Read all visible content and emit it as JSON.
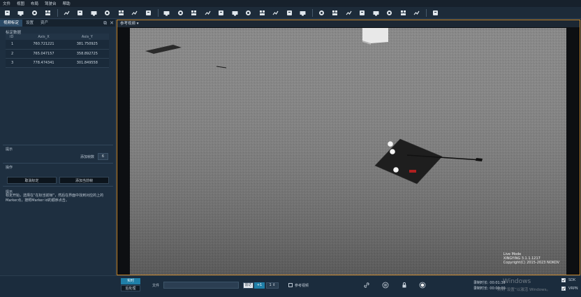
{
  "menu": [
    "文件",
    "视图",
    "布局",
    "驾驶台",
    "帮助"
  ],
  "toolbar_icons": [
    "new-file-icon",
    "open-file-icon",
    "save-icon",
    "save-as-icon",
    "link-icon",
    "export-icon",
    "camera-icon",
    "device-icon",
    "film-icon",
    "layers-icon",
    "stack-icon",
    "monitor-icon",
    "settings-icon",
    "window-icon",
    "window-icon",
    "window-icon",
    "window-icon",
    "window-icon",
    "window-icon",
    "window-icon",
    "window-icon",
    "window-icon",
    "camera-icon",
    "record-icon",
    "globe-icon",
    "gauge-icon",
    "graph-icon",
    "bar-chart-icon",
    "map-pin-icon",
    "folder-icon",
    "list-icon"
  ],
  "left_panel": {
    "tabs": [
      "视频标定",
      "设置",
      "资产"
    ],
    "calib_title": "标定数据",
    "table": {
      "headers": [
        "ID",
        "Axis_X",
        "Axis_Y"
      ],
      "rows": [
        [
          "1",
          "760.721221",
          "381.750925"
        ],
        [
          "2",
          "765.047157",
          "358.892725"
        ],
        [
          "3",
          "778.474341",
          "301.849558"
        ]
      ]
    },
    "tips_title": "提示",
    "add_frames_label": "添加帧数",
    "add_frames_value": "6",
    "ops_title": "操作",
    "cancel_calib": "取消标定",
    "add_current_frame": "添加当前帧",
    "hint_title": "提示",
    "hint_text": "标定开始，选择在“在标当前帧”，然后在界面中找到对应的上的Marker点，按照Marker id的顺序点击。"
  },
  "viewer": {
    "header": "参考视频 ▾",
    "watermark_lines": [
      "Live Mode",
      "XINGYING 3.1.1.1217",
      "Copyright(C) 2015-2023 NOKOV"
    ]
  },
  "bottom": {
    "realtime_btn": "实时",
    "postprocess_btn": "后处理",
    "file_label": "文件",
    "record_btn": "雷达",
    "step_value": "+1",
    "frame_value": "1",
    "reference_video": "参考视频",
    "record_time_label": "录制时长:",
    "record_time_value": "00:01:30",
    "play_time_label": "录制时长:",
    "play_time_value": "00:00:00",
    "sdk": "SDK",
    "vrpn": "VRPN",
    "windows_watermark_1": "Windows",
    "windows_watermark_2": "转到“设置”以激活 Windows。"
  },
  "colors": {
    "accent": "#c7862b",
    "active_tab": "#2b4a66",
    "realtime": "#1f7fa8"
  }
}
